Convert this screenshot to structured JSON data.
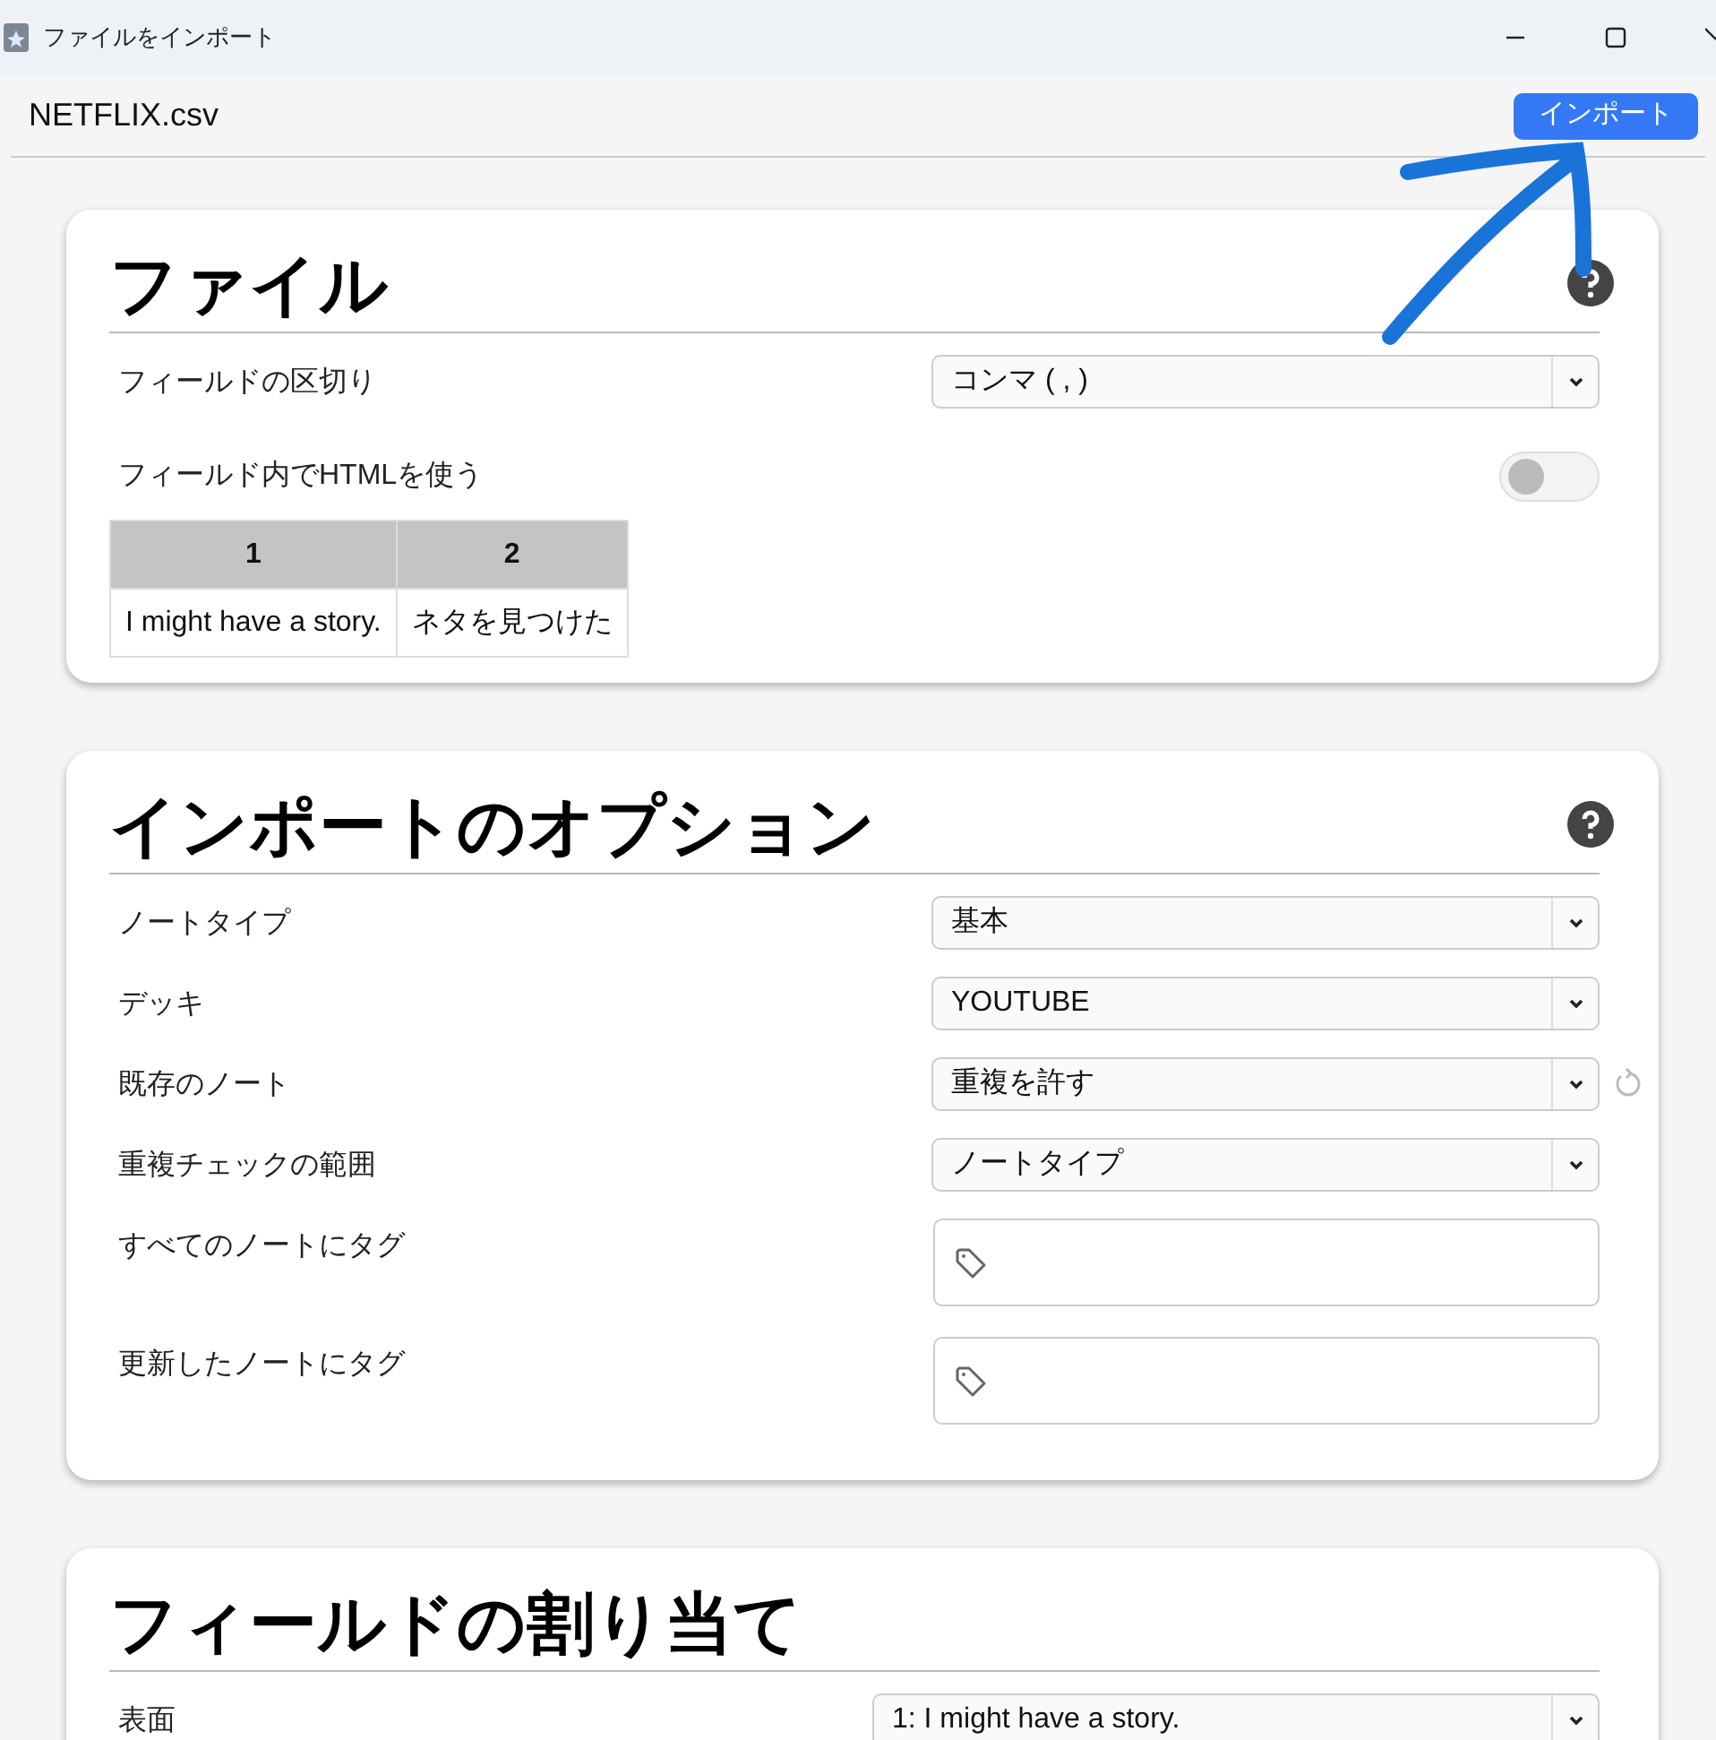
{
  "window": {
    "title": "ファイルをインポート"
  },
  "header": {
    "file_name": "NETFLIX.csv",
    "import_button": "インポート"
  },
  "sections": [
    {
      "title": "ファイル",
      "help": true,
      "rows": [
        {
          "kind": "select",
          "label": "フィールドの区切り",
          "value": "コンマ ( , )",
          "reset": false
        },
        {
          "kind": "toggle",
          "label": "フィールド内でHTMLを使う",
          "on": false
        }
      ],
      "preview": {
        "columns": [
          "1",
          "2"
        ],
        "rows": [
          [
            "I might have a story.",
            "ネタを見つけた"
          ]
        ]
      }
    },
    {
      "title": "インポートのオプション",
      "help": true,
      "rows": [
        {
          "kind": "select",
          "label": "ノートタイプ",
          "value": "基本",
          "reset": false
        },
        {
          "kind": "select",
          "label": "デッキ",
          "value": "YOUTUBE",
          "reset": false
        },
        {
          "kind": "select",
          "label": "既存のノート",
          "value": "重複を許す",
          "reset": true
        },
        {
          "kind": "select",
          "label": "重複チェックの範囲",
          "value": "ノートタイプ",
          "reset": false
        },
        {
          "kind": "tags",
          "label": "すべてのノートにタグ"
        },
        {
          "kind": "tags",
          "label": "更新したノートにタグ"
        }
      ]
    },
    {
      "title": "フィールドの割り当て",
      "help": false,
      "wide": true,
      "rows": [
        {
          "kind": "select",
          "label": "表面",
          "value": "1: I might have a story.",
          "reset": false
        }
      ]
    }
  ]
}
